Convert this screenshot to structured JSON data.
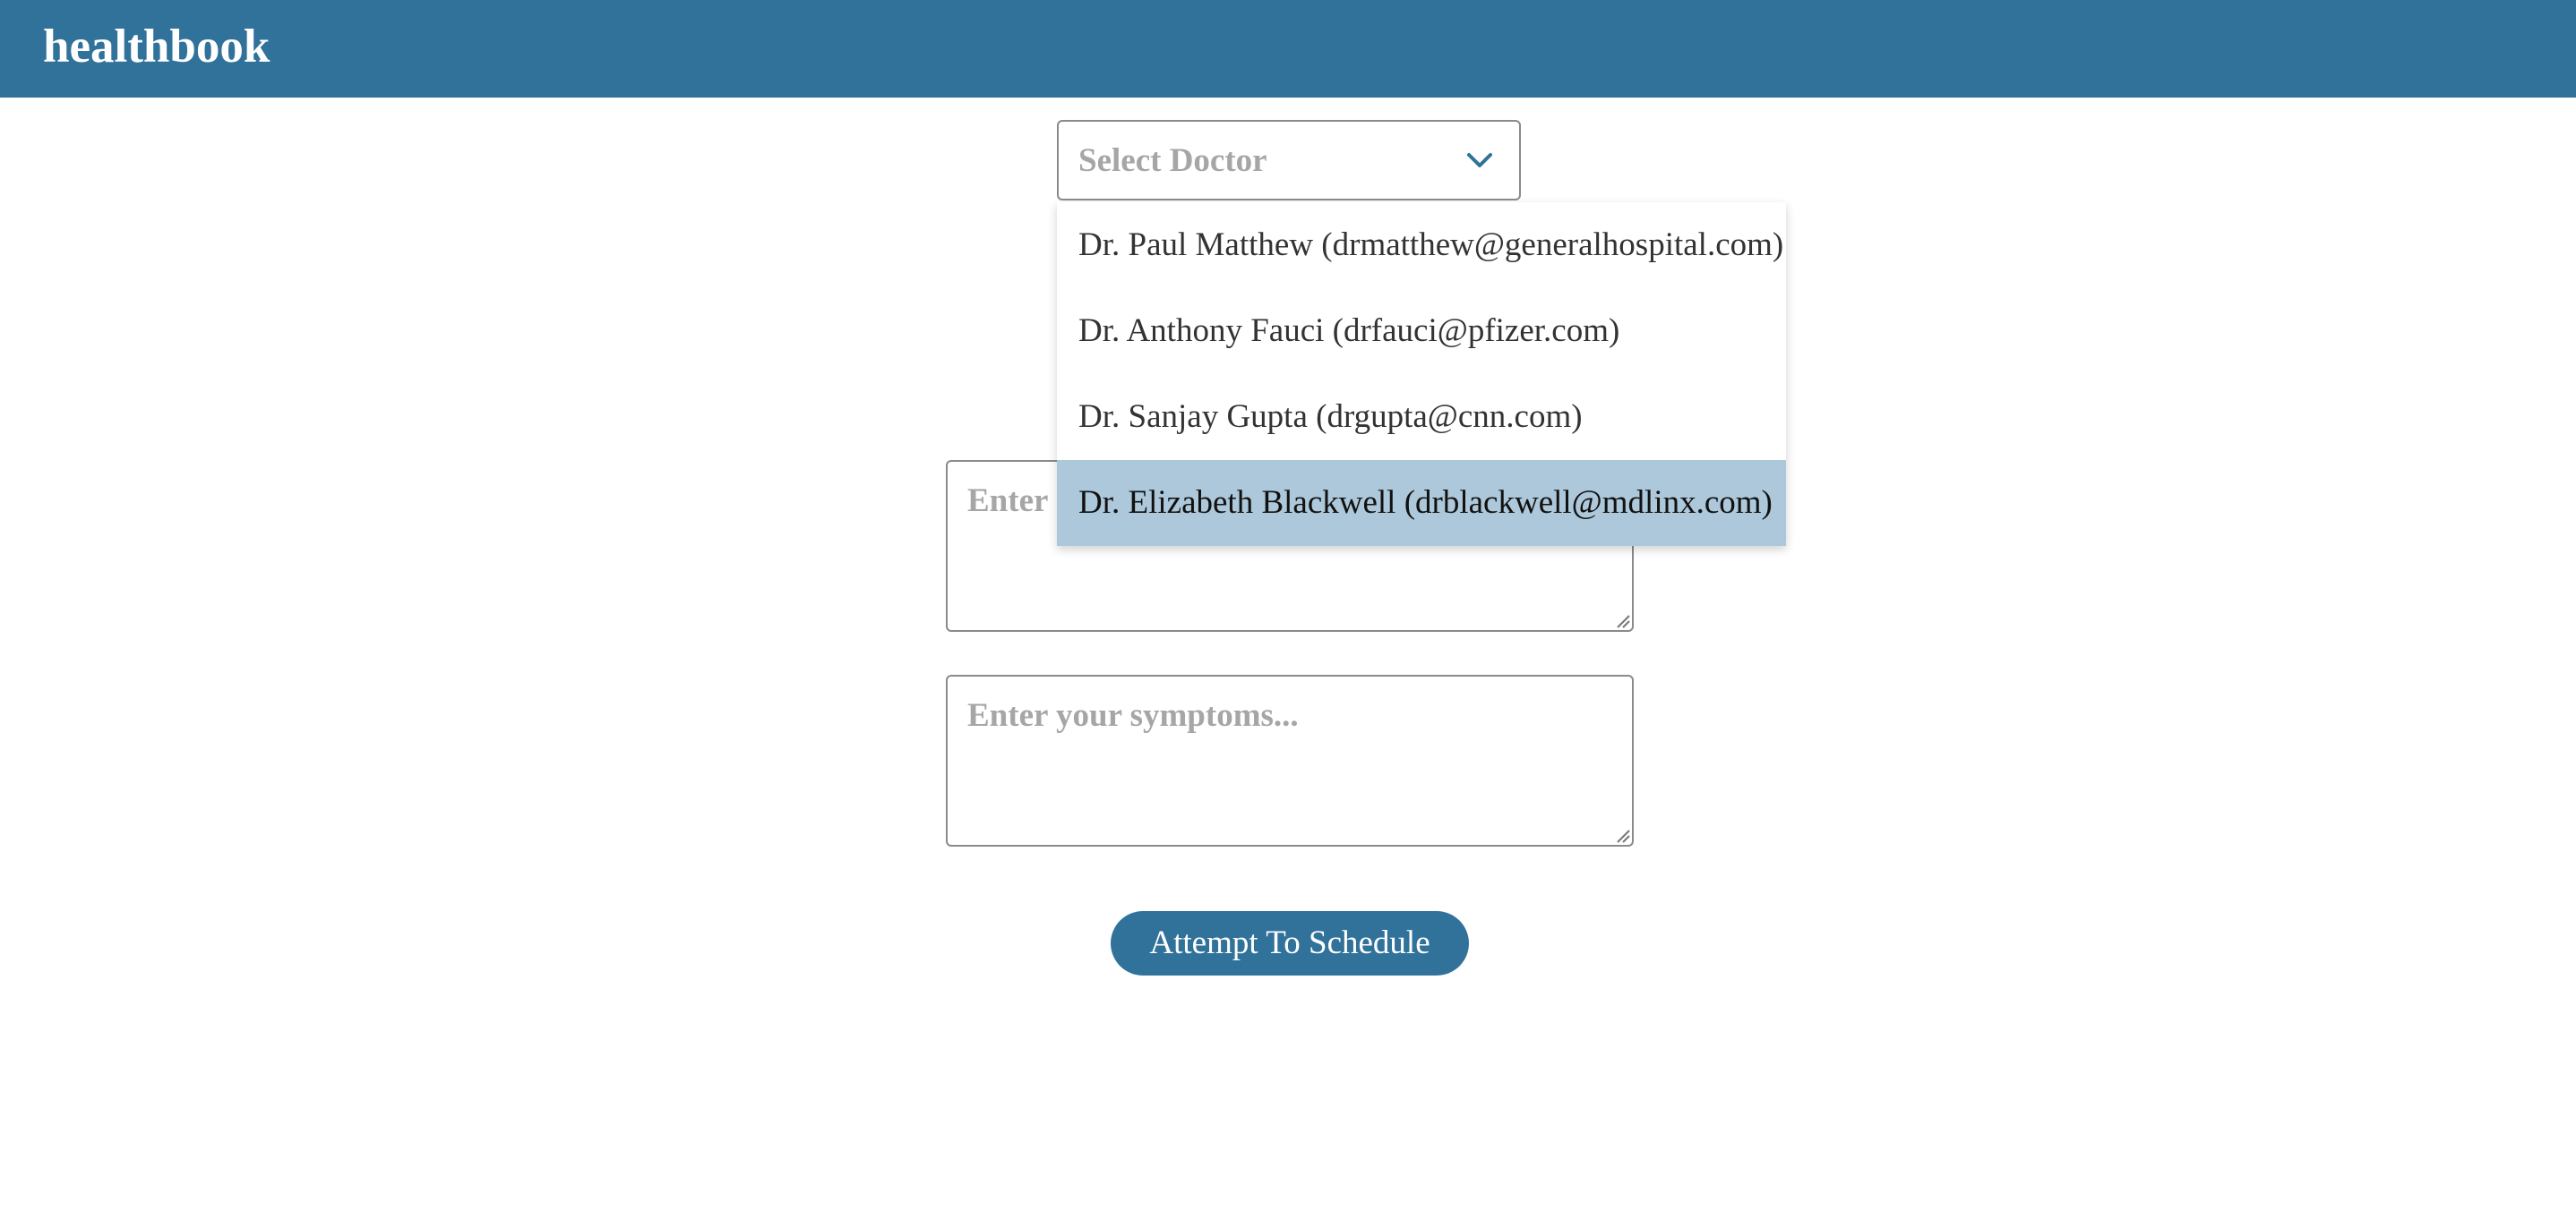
{
  "app": {
    "brand": "healthbook"
  },
  "doctor_select": {
    "placeholder": "Select Doctor",
    "icon": "chevron-down-icon",
    "options": [
      "Dr. Paul Matthew (drmatthew@generalhospital.com)",
      "Dr. Anthony Fauci (drfauci@pfizer.com)",
      "Dr. Sanjay Gupta (drgupta@cnn.com)",
      "Dr. Elizabeth Blackwell (drblackwell@mdlinx.com)"
    ],
    "highlighted_option": "Dr. Elizabeth Blackwell (drblackwell@mdlinx.com)"
  },
  "form": {
    "first_textarea_placeholder_visible": "Enter",
    "symptoms_placeholder": "Enter your symptoms...",
    "submit_label": "Attempt To Schedule"
  },
  "colors": {
    "primary": "#31729b",
    "highlight": "#adc8da",
    "placeholder": "#a6a6a6"
  }
}
